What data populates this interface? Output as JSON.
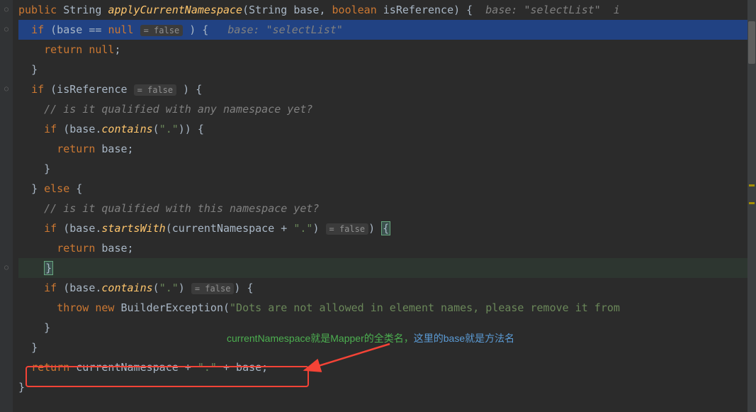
{
  "code": {
    "l1_public": "public",
    "l1_string": "String",
    "l1_method": "applyCurrentNamespace",
    "l1_params": "(String base, ",
    "l1_boolean": "boolean",
    "l1_isref": " isReference) {",
    "l1_hint": "  base: \"selectList\"  i",
    "l2_if": "if",
    "l2_cond": " (base == ",
    "l2_null": "null",
    "l2_hintbox": "= false",
    "l2_close": ") {",
    "l2_hint": "   base: \"selectList\"",
    "l3_return": "return",
    "l3_null": " null",
    "l3_semi": ";",
    "l4_brace": "}",
    "l5_if": "if",
    "l5_cond": " (isReference ",
    "l5_hintbox": "= false",
    "l5_close": ") {",
    "l6_comment": "// is it qualified with any namespace yet?",
    "l7_if": "if",
    "l7_open": " (base.",
    "l7_contains": "contains",
    "l7_args": "(",
    "l7_dot": "\".\"",
    "l7_close": ")) {",
    "l8_return": "return",
    "l8_base": " base;",
    "l9_brace": "}",
    "l10_close": "} ",
    "l10_else": "else",
    "l10_open": " {",
    "l11_comment": "// is it qualified with this namespace yet?",
    "l12_if": "if",
    "l12_open": " (base.",
    "l12_startswith": "startsWith",
    "l12_paren": "(currentNamespace + ",
    "l12_dot": "\".\"",
    "l12_close1": ") ",
    "l12_hintbox": "= false",
    "l12_close2": ") ",
    "l12_brace": "{",
    "l13_return": "return",
    "l13_base": " base;",
    "l14_brace": "}",
    "l15_if": "if",
    "l15_open": " (base.",
    "l15_contains": "contains",
    "l15_paren": "(",
    "l15_dot": "\".\"",
    "l15_close1": ") ",
    "l15_hintbox": "= false",
    "l15_close2": ") {",
    "l16_throw": "throw",
    "l16_new": " new",
    "l16_class": " BuilderException",
    "l16_open": "(",
    "l16_msg": "\"Dots are not allowed in element names, please remove it from",
    "l17_brace": "}",
    "l18_brace": "}",
    "l19_return": "return",
    "l19_expr1": " currentNamespace + ",
    "l19_dot": "\".\"",
    "l19_expr2": " + base;",
    "l20_brace": "}"
  },
  "annotation": {
    "green": "currentNamespace就是Mapper的全类名，",
    "blue": "这里的base就是方法名"
  }
}
